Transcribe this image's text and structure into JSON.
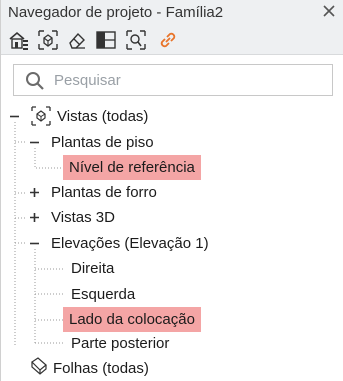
{
  "window": {
    "title": "Navegador de projeto - Família2"
  },
  "toolbar": {
    "buttons": [
      "home-structure-icon",
      "view-cube-icon",
      "eraser-icon",
      "section-split-icon",
      "zoom-frame-icon",
      "link-icon"
    ]
  },
  "search": {
    "placeholder": "Pesquisar"
  },
  "tree": {
    "root_views": "Vistas (todas)",
    "floor_plans": "Plantas de piso",
    "ref_level": "Nível de referência",
    "ceiling_plans": "Plantas de forro",
    "views_3d": "Vistas 3D",
    "elevations": "Elevações (Elevação 1)",
    "elev_right": "Direita",
    "elev_left": "Esquerda",
    "elev_placement": "Lado da colocação",
    "elev_back": "Parte posterior",
    "sheets": "Folhas (todas)"
  },
  "colors": {
    "highlight": "#f4a5a5",
    "link_icon": "#e8742a",
    "chrome": "#eef0f2"
  }
}
